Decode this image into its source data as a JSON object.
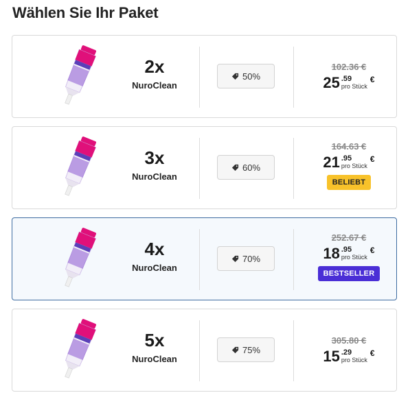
{
  "page": {
    "title": "Wählen Sie Ihr Paket"
  },
  "colors": {
    "accent": "#4a2ed6",
    "badge_yellow": "#f8c22a",
    "selected_border": "#3b6aa0",
    "tube_pink": "#e0107a",
    "tube_purple": "#8c5ad2"
  },
  "packages": [
    {
      "qty": "2x",
      "name": "NuroClean",
      "discount": "50%",
      "old_price": "102.36 €",
      "price_int": "25",
      "price_dec": ".59",
      "per": "pro Stück",
      "currency": "€",
      "badge": ""
    },
    {
      "qty": "3x",
      "name": "NuroClean",
      "discount": "60%",
      "old_price": "164.63 €",
      "price_int": "21",
      "price_dec": ".95",
      "per": "pro Stück",
      "currency": "€",
      "badge": "BELIEBT"
    },
    {
      "qty": "4x",
      "name": "NuroClean",
      "discount": "70%",
      "old_price": "252.67 €",
      "price_int": "18",
      "price_dec": ".95",
      "per": "pro Stück",
      "currency": "€",
      "badge": "BESTSELLER",
      "selected": true
    },
    {
      "qty": "5x",
      "name": "NuroClean",
      "discount": "75%",
      "old_price": "305.80 €",
      "price_int": "15",
      "price_dec": ".29",
      "per": "pro Stück",
      "currency": "€",
      "badge": ""
    }
  ]
}
